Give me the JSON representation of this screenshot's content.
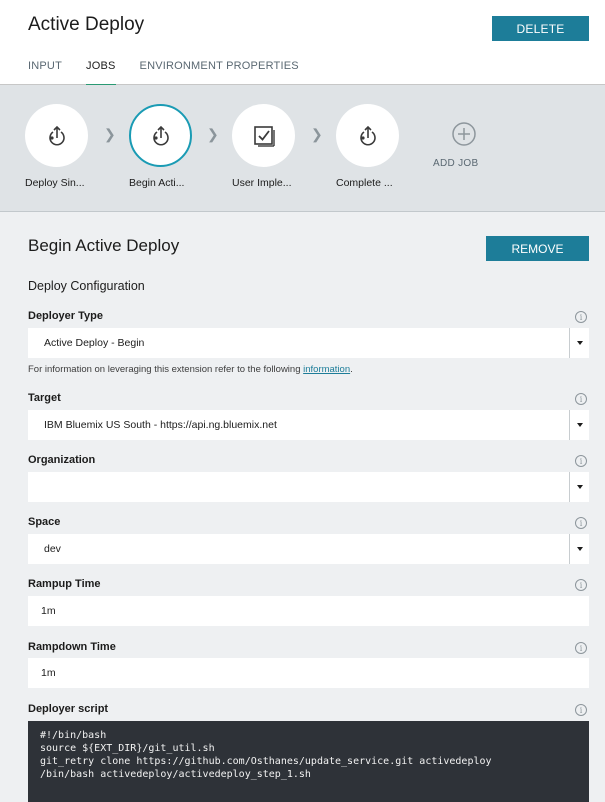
{
  "header": {
    "title": "Active Deploy",
    "delete_label": "DELETE",
    "tabs": [
      {
        "label": "INPUT",
        "active": false
      },
      {
        "label": "JOBS",
        "active": true
      },
      {
        "label": "ENVIRONMENT PROPERTIES",
        "active": false
      }
    ]
  },
  "pipeline": {
    "jobs": [
      {
        "label": "Deploy Sin...",
        "icon": "deploy-icon",
        "selected": false
      },
      {
        "label": "Begin Acti...",
        "icon": "deploy-icon",
        "selected": true
      },
      {
        "label": "User Imple...",
        "icon": "checklist-icon",
        "selected": false
      },
      {
        "label": "Complete ...",
        "icon": "deploy-icon",
        "selected": false
      }
    ],
    "add_job_label": "ADD JOB"
  },
  "config": {
    "title": "Begin Active Deploy",
    "remove_label": "REMOVE",
    "subsection": "Deploy Configuration",
    "deployer_type": {
      "label": "Deployer Type",
      "value": "Active Deploy - Begin"
    },
    "help": {
      "text": "For information on leveraging this extension refer to the following ",
      "link": "information",
      "suffix": "."
    },
    "target": {
      "label": "Target",
      "value": "IBM Bluemix US South - https://api.ng.bluemix.net"
    },
    "organization": {
      "label": "Organization",
      "value": ""
    },
    "space": {
      "label": "Space",
      "value": "dev"
    },
    "rampup": {
      "label": "Rampup Time",
      "value": "1m"
    },
    "rampdown": {
      "label": "Rampdown Time",
      "value": "1m"
    },
    "script": {
      "label": "Deployer script",
      "content": "#!/bin/bash\nsource ${EXT_DIR}/git_util.sh\ngit_retry clone https://github.com/Osthanes/update_service.git activedeploy\n/bin/bash activedeploy/activedeploy_step_1.sh"
    },
    "info_glyph": "i"
  },
  "colors": {
    "accent": "#1d7d99",
    "tab_underline": "#2a9a73",
    "selected_ring": "#1a9bb4"
  }
}
